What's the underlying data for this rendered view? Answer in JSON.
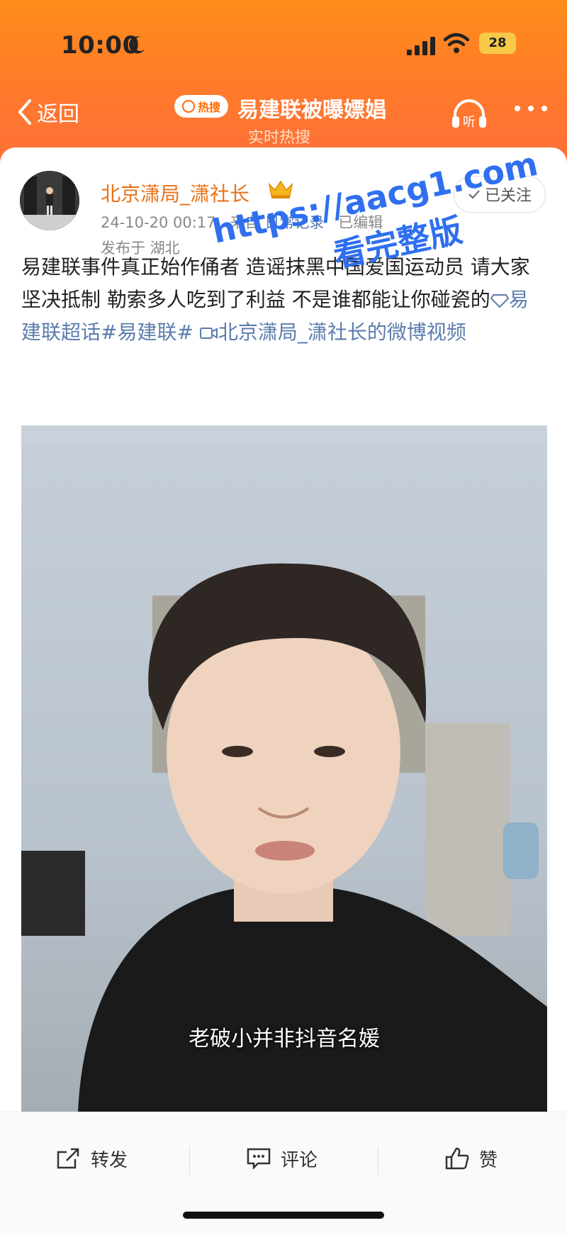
{
  "status_bar": {
    "time": "10:00",
    "battery": "28"
  },
  "nav": {
    "back_label": "返回",
    "hot_badge": "热搜",
    "title": "易建联被曝嫖娼",
    "subtitle": "实时热搜",
    "listen_label": "听"
  },
  "post": {
    "author": "北京潇局_潇社长",
    "timestamp": "24-10-20 00:17",
    "source_prefix": "来自",
    "source": "日常记录",
    "edited": "已编辑",
    "location": "发布于 湖北",
    "follow_label": "已关注",
    "text_main": "易建联事件真正始作俑者 造谣抹黑中国爱国运动员 请大家坚决抵制 勒索多人吃到了利益 不是谁都能让你碰瓷的",
    "supertopic": "易建联超话",
    "hashtag": "#易建联#",
    "video_link": "北京潇局_潇社长的微博视频",
    "video_subtitle": "老破小并非抖音名媛"
  },
  "watermark": {
    "line1": "https://aacg1.com",
    "line2": "看完整版"
  },
  "actions": {
    "repost": "转发",
    "comment": "评论",
    "like": "赞"
  }
}
